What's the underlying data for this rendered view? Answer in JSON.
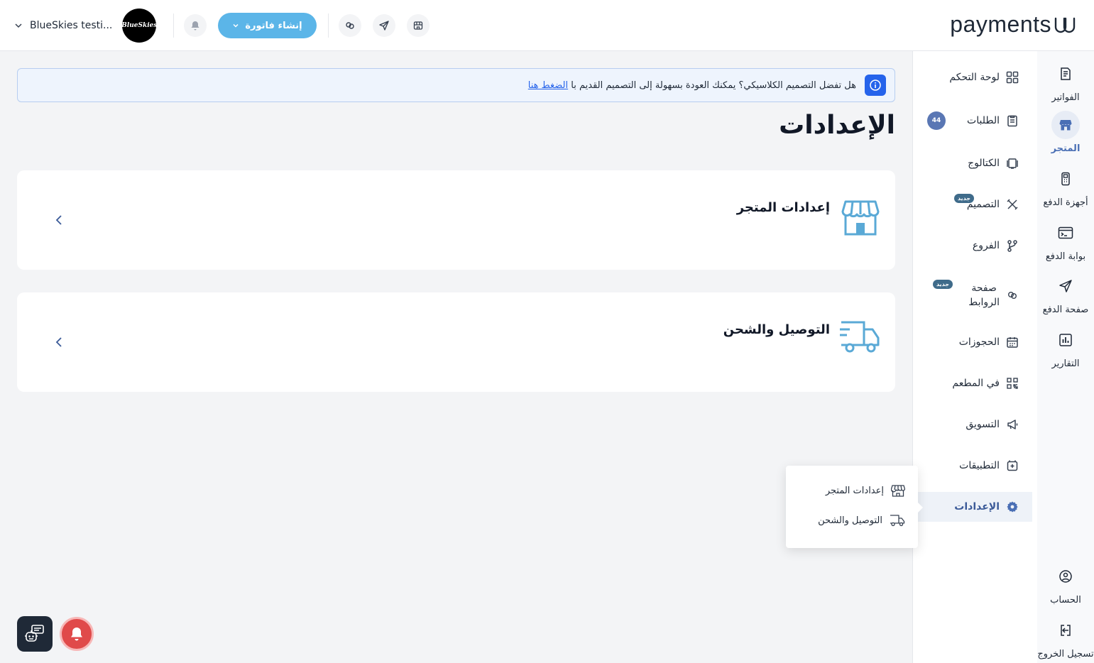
{
  "header": {
    "logo_text": "payments",
    "store_name": "BlueSkies testi...",
    "avatar_text": "BlueSkies",
    "create_invoice_label": "إنشاء فاتورة"
  },
  "banner": {
    "text": "هل تفضل التصميم الكلاسيكي؟ يمكنك العودة بسهولة إلى التصميم القديم با",
    "link": "الضغط هنا"
  },
  "page": {
    "title": "الإعدادات"
  },
  "cards": [
    {
      "title": "إعدادات المتجر"
    },
    {
      "title": "التوصيل والشحن"
    }
  ],
  "sub_sidebar": {
    "items": [
      {
        "label": "لوحة التحكم"
      },
      {
        "label": "الطلبات",
        "badge": "44"
      },
      {
        "label": "الكتالوج"
      },
      {
        "label": "التصميم",
        "badge": "جديد"
      },
      {
        "label": "الفروع"
      },
      {
        "label": "صفحة الروابط",
        "line1": "صفحة",
        "line2": "الروابط",
        "badge": "جديد"
      },
      {
        "label": "الحجوزات"
      },
      {
        "label": "في المطعم"
      },
      {
        "label": "التسويق"
      },
      {
        "label": "التطبيقات"
      },
      {
        "label": "الإعدادات",
        "active": true
      }
    ]
  },
  "prim_sidebar": {
    "items": [
      {
        "label": "الفواتير"
      },
      {
        "label": "المتجر",
        "active": true
      },
      {
        "label": "أجهزة الدفع"
      },
      {
        "label": "بوابة الدفع"
      },
      {
        "label": "صفحة الدفع"
      },
      {
        "label": "التقارير"
      },
      {
        "label": "الحساب"
      },
      {
        "label": "تسجيل الخروج"
      }
    ]
  },
  "flyout": {
    "items": [
      {
        "label": "إعدادات المتجر"
      },
      {
        "label": "التوصيل والشحن"
      }
    ]
  },
  "colors": {
    "accent": "#4a6fb5",
    "invoice_button": "#5bb5e8",
    "icon_blue": "#5aa9d6",
    "alert_red": "#e04a4a"
  }
}
